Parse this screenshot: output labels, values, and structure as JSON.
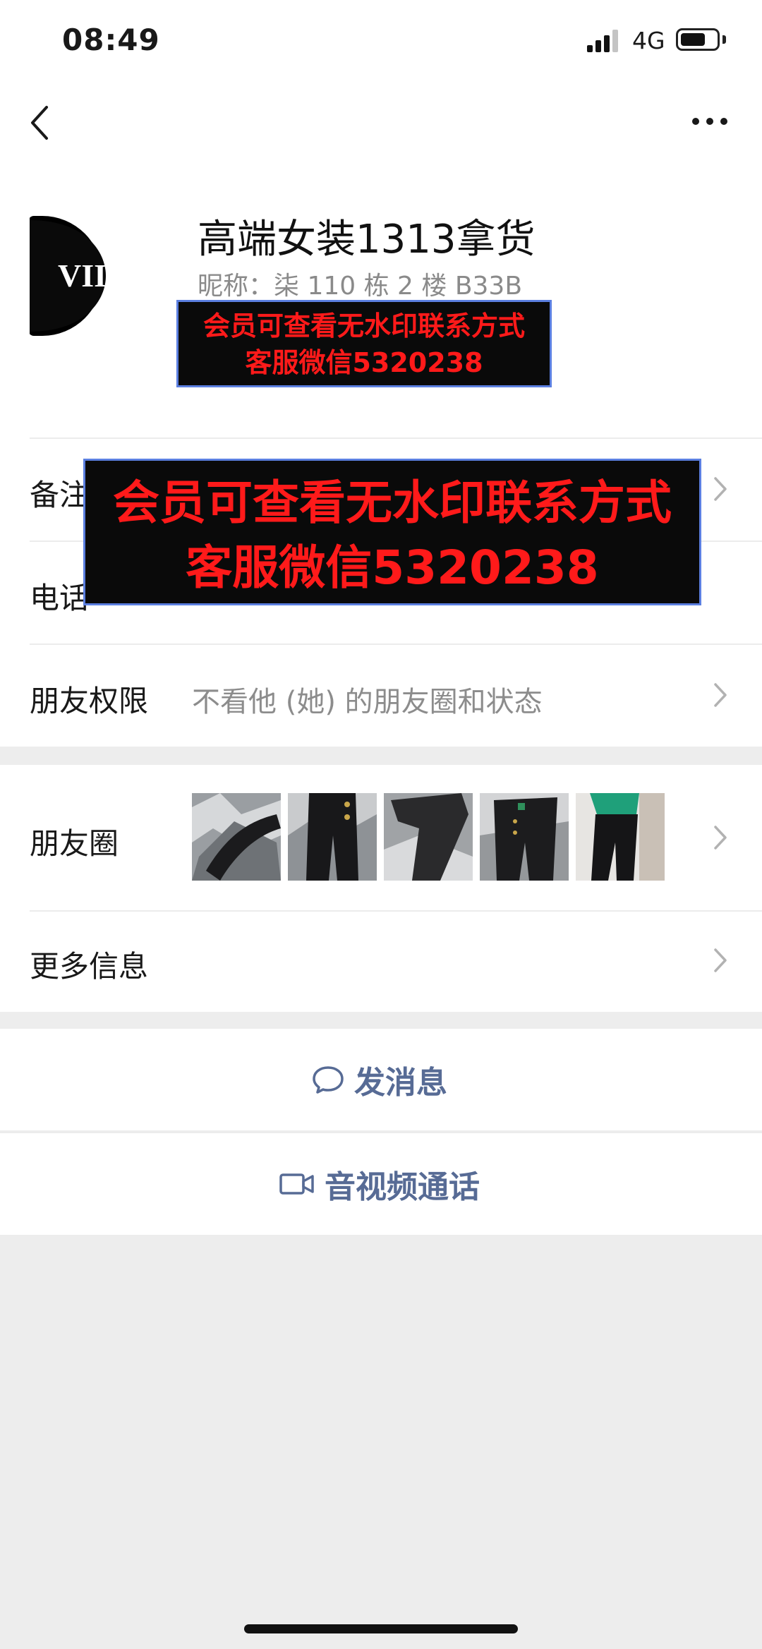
{
  "status_bar": {
    "time": "08:49",
    "network": "4G"
  },
  "profile": {
    "name": "高端女装1313拿货",
    "nickname": "昵称：柒 110 栋 2 楼 B33B"
  },
  "watermarks": {
    "small": {
      "line1": "会员可查看无水印联系方式",
      "line2": "客服微信5320238"
    },
    "big": {
      "line1": "会员可查看无水印联系方式",
      "line2": "客服微信5320238"
    }
  },
  "rows": {
    "remark": {
      "label": "备注"
    },
    "phone": {
      "label": "电话"
    },
    "permission": {
      "label": "朋友权限",
      "value": "不看他 (她) 的朋友圈和状态"
    },
    "moments": {
      "label": "朋友圈"
    },
    "more_info": {
      "label": "更多信息"
    }
  },
  "actions": {
    "message": "发消息",
    "call": "音视频通话"
  },
  "colors": {
    "link": "#576b95",
    "watermark_text": "#ff1a1a",
    "background": "#ededed"
  },
  "icons": [
    "back-icon",
    "more-icon",
    "chevron-right-icon",
    "chat-bubble-icon",
    "video-call-icon",
    "signal-icon",
    "battery-icon"
  ]
}
